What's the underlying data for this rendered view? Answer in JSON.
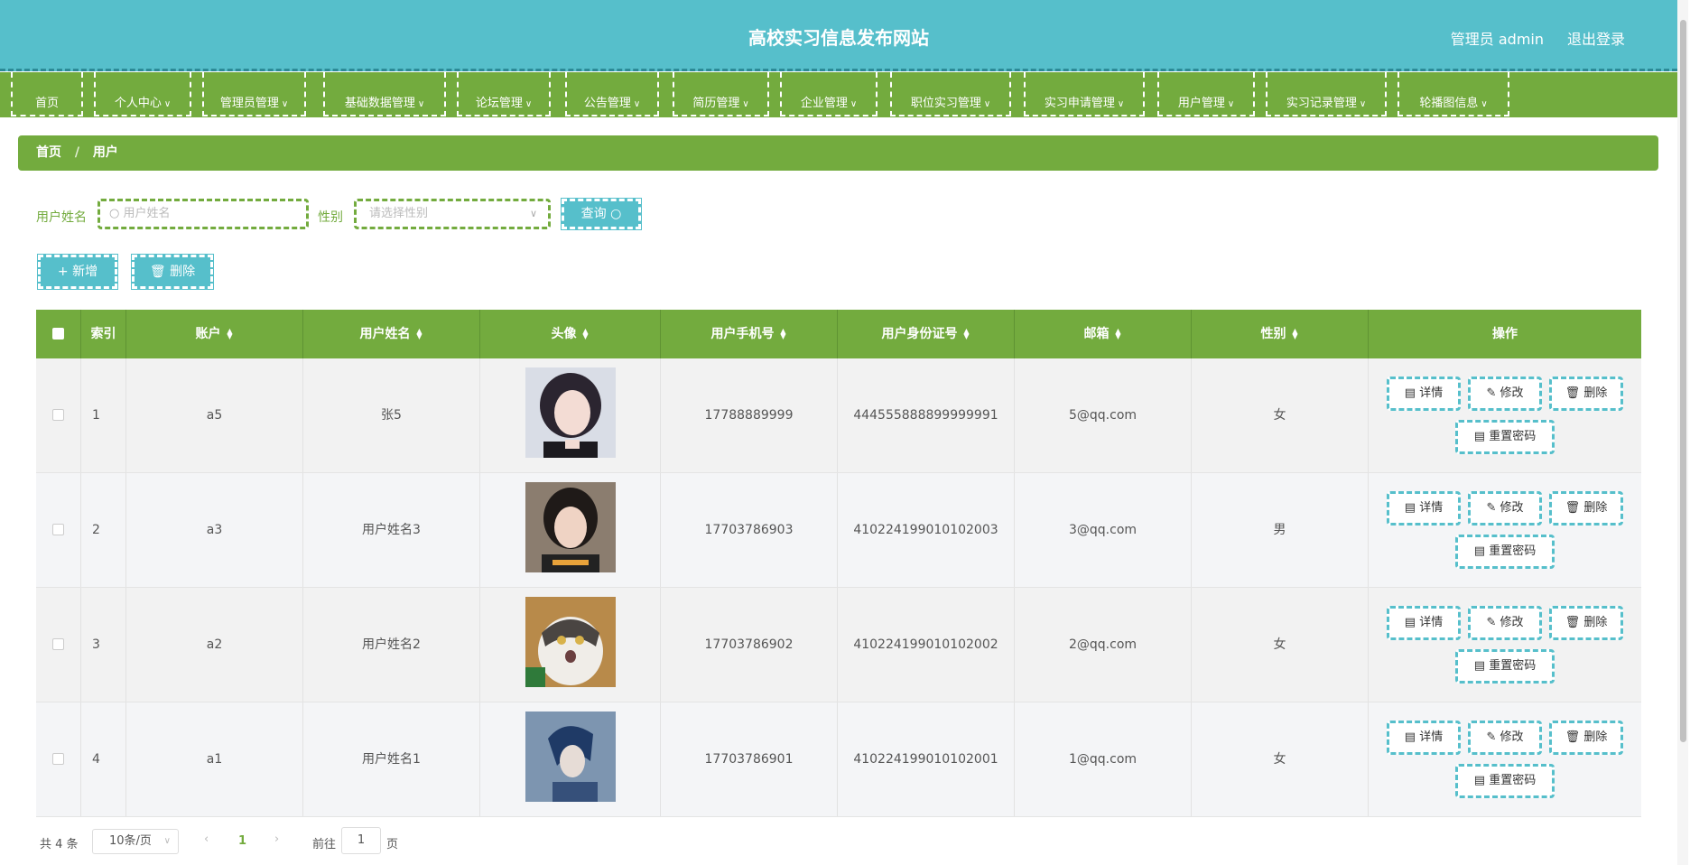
{
  "header": {
    "title": "高校实习信息发布网站",
    "admin": "管理员 admin",
    "logout": "退出登录"
  },
  "nav": [
    "首页",
    "个人中心",
    "管理员管理",
    "基础数据管理",
    "论坛管理",
    "公告管理",
    "简历管理",
    "企业管理",
    "职位实习管理",
    "实习申请管理",
    "用户管理",
    "实习记录管理",
    "轮播图信息"
  ],
  "breadcrumb": {
    "home": "首页",
    "sep": "/",
    "current": "用户"
  },
  "search": {
    "name_label": "用户姓名",
    "name_placeholder": "用户姓名",
    "gender_label": "性别",
    "gender_placeholder": "请选择性别",
    "query": "查询"
  },
  "actions": {
    "add": "新增",
    "delete": "删除"
  },
  "columns": [
    "索引",
    "账户",
    "用户姓名",
    "头像",
    "用户手机号",
    "用户身份证号",
    "邮箱",
    "性别",
    "操作"
  ],
  "rows": [
    {
      "index": "1",
      "account": "a5",
      "name": "张5",
      "phone": "17788889999",
      "idcard": "444555888899999991",
      "email": "5@qq.com",
      "gender": "女"
    },
    {
      "index": "2",
      "account": "a3",
      "name": "用户姓名3",
      "phone": "17703786903",
      "idcard": "410224199010102003",
      "email": "3@qq.com",
      "gender": "男"
    },
    {
      "index": "3",
      "account": "a2",
      "name": "用户姓名2",
      "phone": "17703786902",
      "idcard": "410224199010102002",
      "email": "2@qq.com",
      "gender": "女"
    },
    {
      "index": "4",
      "account": "a1",
      "name": "用户姓名1",
      "phone": "17703786901",
      "idcard": "410224199010102001",
      "email": "1@qq.com",
      "gender": "女"
    }
  ],
  "row_ops": {
    "detail": "详情",
    "edit": "修改",
    "delete": "删除",
    "reset": "重置密码"
  },
  "pagination": {
    "total": "共 4 条",
    "size": "10条/页",
    "page": "1",
    "goto": "前往",
    "goto_value": "1",
    "page_unit": "页"
  },
  "colors": {
    "header": "#56bfcb",
    "nav": "#73ab3e"
  }
}
